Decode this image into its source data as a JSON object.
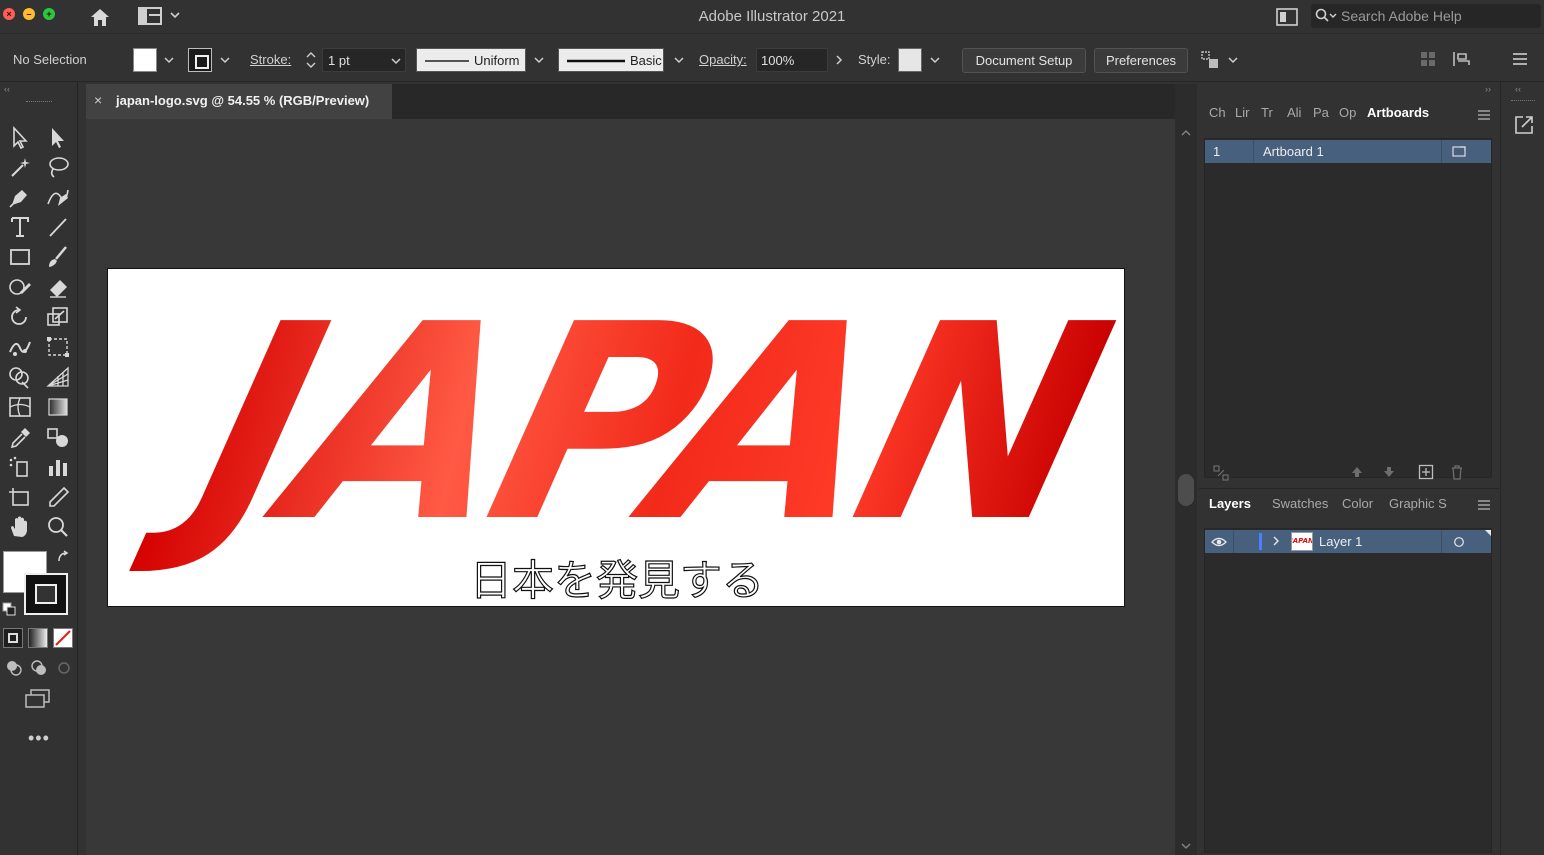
{
  "app": {
    "title": "Adobe Illustrator 2021",
    "help_search_placeholder": "Search Adobe Help"
  },
  "controlbar": {
    "selection_status": "No Selection",
    "stroke_label": "Stroke:",
    "stroke_weight": "1 pt",
    "variable_width_profile": "Uniform",
    "brush_definition": "Basic",
    "opacity_label": "Opacity:",
    "opacity_value": "100%",
    "style_label": "Style:",
    "document_setup_label": "Document Setup",
    "preferences_label": "Preferences"
  },
  "document": {
    "tab_title": "japan-logo.svg @ 54.55 % (RGB/Preview)",
    "artwork_title": "JAPAN",
    "artwork_subtitle": "日本を発見する",
    "artwork_colors": {
      "light": "#ff5a44",
      "mid": "#f22a1a",
      "dark": "#d20000"
    }
  },
  "artboards_panel": {
    "tabs": [
      "Ch",
      "Lir",
      "Tr",
      "Ali",
      "Pa",
      "Op",
      "Artboards"
    ],
    "active_tab": "Artboards",
    "rows": [
      {
        "number": "1",
        "name": "Artboard 1"
      }
    ]
  },
  "layers_panel": {
    "tabs": [
      "Layers",
      "Swatches",
      "Color",
      "Graphic S"
    ],
    "active_tab": "Layers",
    "rows": [
      {
        "name": "Layer 1",
        "color": "#4f7dff"
      }
    ]
  },
  "icons": {
    "home": "home-icon",
    "workspace": "workspace-switcher-icon",
    "arrange": "arrange-documents-icon",
    "search": "search-icon",
    "align": "align-icon",
    "more": "more-tools-icon"
  }
}
